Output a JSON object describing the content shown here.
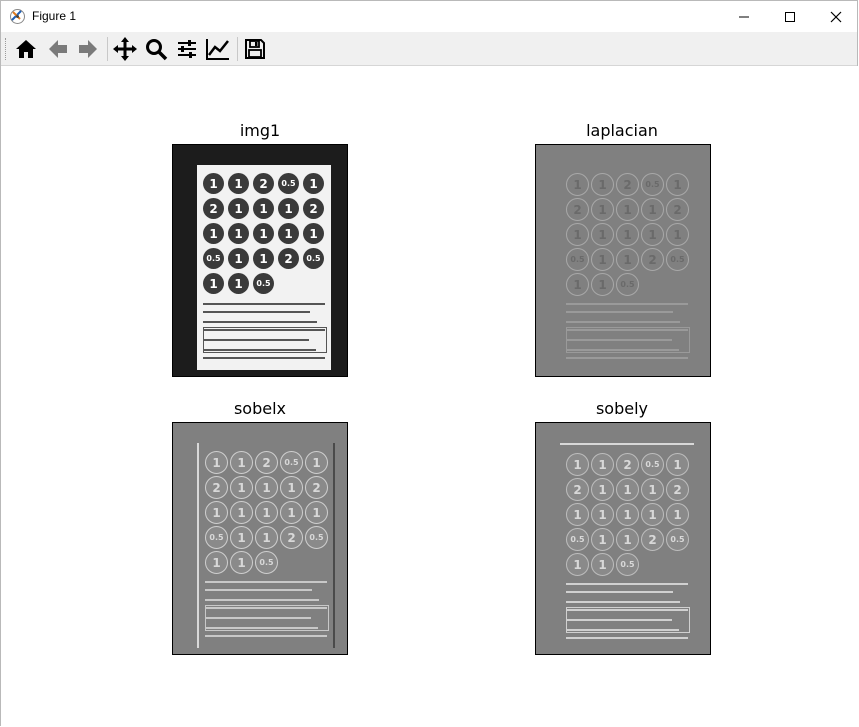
{
  "window": {
    "title": "Figure 1"
  },
  "toolbar": {
    "buttons": [
      {
        "name": "home-icon"
      },
      {
        "name": "back-arrow-icon"
      },
      {
        "name": "forward-arrow-icon"
      },
      {
        "name": "pan-move-icon"
      },
      {
        "name": "zoom-magnifier-icon"
      },
      {
        "name": "configure-subplots-icon"
      },
      {
        "name": "edit-axis-icon"
      },
      {
        "name": "save-floppy-icon"
      }
    ]
  },
  "figure": {
    "subplots": [
      {
        "title": "img1",
        "style": "photo"
      },
      {
        "title": "laplacian",
        "style": "laplacian"
      },
      {
        "title": "sobelx",
        "style": "sobelx"
      },
      {
        "title": "sobely",
        "style": "sobely"
      }
    ],
    "sheet_numbers": [
      [
        "1",
        "1",
        "2",
        "0.5",
        "1"
      ],
      [
        "2",
        "1",
        "1",
        "1",
        "2"
      ],
      [
        "1",
        "1",
        "1",
        "1",
        "1"
      ],
      [
        "0.5",
        "1",
        "1",
        "2",
        "0.5"
      ],
      [
        "1",
        "1",
        "0.5"
      ]
    ]
  },
  "colors": {
    "toolbar_bg": "#f0f0f0",
    "filtered_gray": "#808080",
    "photo_bg": "#1c1c1c"
  }
}
